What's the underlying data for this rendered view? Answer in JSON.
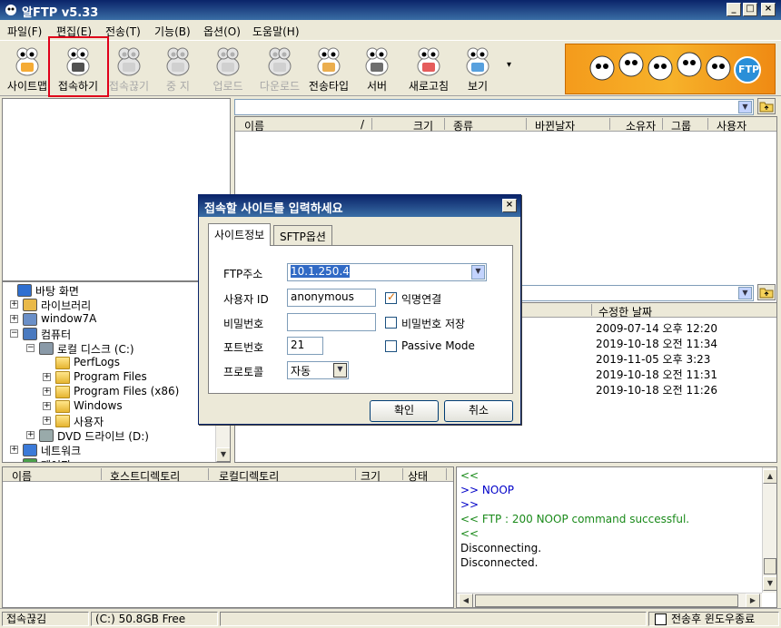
{
  "window": {
    "title": "알FTP v5.33",
    "min_btn": "_",
    "max_btn": "□",
    "close_btn": "×"
  },
  "menu": [
    "파일(F)",
    "편집(E)",
    "전송(T)",
    "기능(B)",
    "옵션(O)",
    "도움말(H)"
  ],
  "toolbar": {
    "items": [
      {
        "label": "사이트맵",
        "icon": "sitemap-icon",
        "enabled": true
      },
      {
        "label": "접속하기",
        "icon": "connect-icon",
        "enabled": true
      },
      {
        "label": "접속끊기",
        "icon": "disconnect-icon",
        "enabled": false
      },
      {
        "label": "중 지",
        "icon": "stop-icon",
        "enabled": false
      },
      {
        "label": "업로드",
        "icon": "upload-icon",
        "enabled": false
      },
      {
        "label": "다운로드",
        "icon": "download-icon",
        "enabled": false
      },
      {
        "label": "전송타입",
        "icon": "transfer-type-icon",
        "enabled": true
      },
      {
        "label": "서버",
        "icon": "server-icon",
        "enabled": true
      },
      {
        "label": "새로고침",
        "icon": "refresh-icon",
        "enabled": true
      },
      {
        "label": "보기",
        "icon": "view-icon",
        "enabled": true
      }
    ],
    "more": "▾",
    "banner_text": "FTP"
  },
  "remote_panel": {
    "columns": [
      "이름",
      "/",
      "크기",
      "종류",
      "바뀐날자",
      "소유자",
      "그룹",
      "사용자"
    ]
  },
  "local_tree": {
    "items": [
      {
        "label": "바탕 화면",
        "expander": ""
      },
      {
        "label": "라이브러리",
        "expander": "+"
      },
      {
        "label": "window7A",
        "expander": "+"
      },
      {
        "label": "컴퓨터",
        "expander": "−"
      },
      {
        "label": "로컬 디스크 (C:)",
        "expander": "−"
      },
      {
        "label": "PerfLogs",
        "expander": ""
      },
      {
        "label": "Program Files",
        "expander": "+"
      },
      {
        "label": "Program Files (x86)",
        "expander": "+"
      },
      {
        "label": "Windows",
        "expander": "+"
      },
      {
        "label": "사용자",
        "expander": "+"
      },
      {
        "label": "DVD 드라이브 (D:)",
        "expander": "+"
      },
      {
        "label": "네트워크",
        "expander": "+"
      },
      {
        "label": "제어판",
        "expander": ""
      }
    ]
  },
  "local_files": {
    "column_modified": "수정한 날짜",
    "dates": [
      "2009-07-14 오후 12:20",
      "2019-10-18 오전 11:34",
      "2019-11-05 오후 3:23",
      "2019-10-18 오전 11:31",
      "2019-10-18 오전 11:26"
    ]
  },
  "queue": {
    "columns": [
      "이름",
      "호스트디렉토리",
      "로컬디렉토리",
      "크기",
      "상태"
    ]
  },
  "log": [
    {
      "text": "<<",
      "style": "green"
    },
    {
      "text": ">> NOOP",
      "style": "blue"
    },
    {
      "text": ">>",
      "style": "blue"
    },
    {
      "text": "<< FTP : 200 NOOP command successful.",
      "style": "green"
    },
    {
      "text": "<<",
      "style": "green"
    },
    {
      "text": "Disconnecting.",
      "style": "black"
    },
    {
      "text": "Disconnected.",
      "style": "black"
    }
  ],
  "status": {
    "state": "접속끊김",
    "drive": "(C:)  50.8GB Free",
    "close_after_label": "전송후 윈도우종료"
  },
  "dialog": {
    "title": "접속할 사이트를 입력하세요",
    "close": "×",
    "tabs": [
      "사이트정보",
      "SFTP옵션"
    ],
    "ftp_label": "FTP주소",
    "ftp_value": "10.1.250.4",
    "user_label": "사용자 ID",
    "user_value": "anonymous",
    "anon_label": "익명연결",
    "anon_checked": true,
    "password_label": "비밀번호",
    "password_value": "",
    "save_pw_label": "비밀번호 저장",
    "save_pw_checked": false,
    "port_label": "포트번호",
    "port_value": "21",
    "passive_label": "Passive Mode",
    "passive_checked": false,
    "protocol_label": "프로토콜",
    "protocol_value": "자동",
    "ok": "확인",
    "cancel": "취소"
  },
  "colors": {
    "title_bar": "#0a246a",
    "highlight_box": "#e0001a",
    "log_blue": "#0000c8",
    "log_green": "#1a8a1a",
    "banner": "#f49b1c"
  }
}
